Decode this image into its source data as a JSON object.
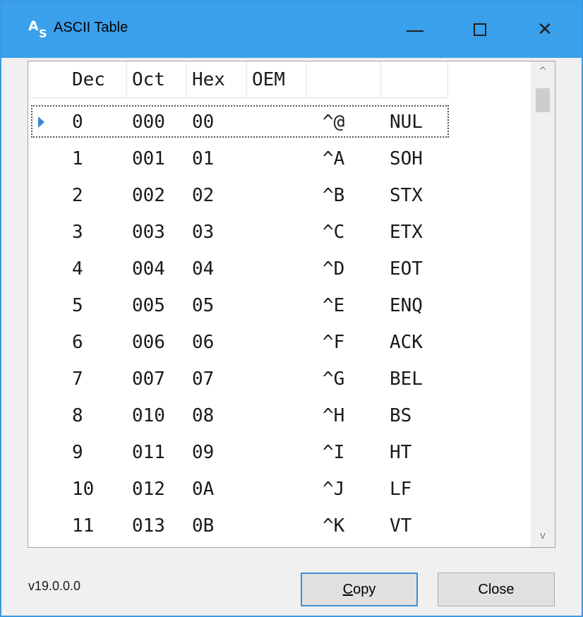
{
  "window": {
    "title": "ASCII Table",
    "icon": "ascii-table-app-icon",
    "icon_glyph_a": "A",
    "icon_glyph_s": "S",
    "accent_color": "#3aa0ec",
    "controls": {
      "minimize": "minimize-icon",
      "maximize": "maximize-icon",
      "close_glyph": "✕"
    }
  },
  "grid": {
    "headers": [
      "Dec",
      "Oct",
      "Hex",
      "OEM",
      "",
      ""
    ],
    "selected_row": 0,
    "rows": [
      {
        "dec": "0",
        "oct": "000",
        "hex": "00",
        "oem": "",
        "ctrl": "^@",
        "name": "NUL"
      },
      {
        "dec": "1",
        "oct": "001",
        "hex": "01",
        "oem": "",
        "ctrl": "^A",
        "name": "SOH"
      },
      {
        "dec": "2",
        "oct": "002",
        "hex": "02",
        "oem": "",
        "ctrl": "^B",
        "name": "STX"
      },
      {
        "dec": "3",
        "oct": "003",
        "hex": "03",
        "oem": "",
        "ctrl": "^C",
        "name": "ETX"
      },
      {
        "dec": "4",
        "oct": "004",
        "hex": "04",
        "oem": "",
        "ctrl": "^D",
        "name": "EOT"
      },
      {
        "dec": "5",
        "oct": "005",
        "hex": "05",
        "oem": "",
        "ctrl": "^E",
        "name": "ENQ"
      },
      {
        "dec": "6",
        "oct": "006",
        "hex": "06",
        "oem": "",
        "ctrl": "^F",
        "name": "ACK"
      },
      {
        "dec": "7",
        "oct": "007",
        "hex": "07",
        "oem": "",
        "ctrl": "^G",
        "name": "BEL"
      },
      {
        "dec": "8",
        "oct": "010",
        "hex": "08",
        "oem": "",
        "ctrl": "^H",
        "name": "BS"
      },
      {
        "dec": "9",
        "oct": "011",
        "hex": "09",
        "oem": "",
        "ctrl": "^I",
        "name": "HT"
      },
      {
        "dec": "10",
        "oct": "012",
        "hex": "0A",
        "oem": "",
        "ctrl": "^J",
        "name": "LF"
      },
      {
        "dec": "11",
        "oct": "013",
        "hex": "0B",
        "oem": "",
        "ctrl": "^K",
        "name": "VT"
      }
    ],
    "scroll": {
      "up_arrow": "^",
      "down_arrow": "v"
    }
  },
  "footer": {
    "version": "v19.0.0.0",
    "copy_mnemonic": "C",
    "copy_rest": "opy",
    "close_label": "Close"
  }
}
